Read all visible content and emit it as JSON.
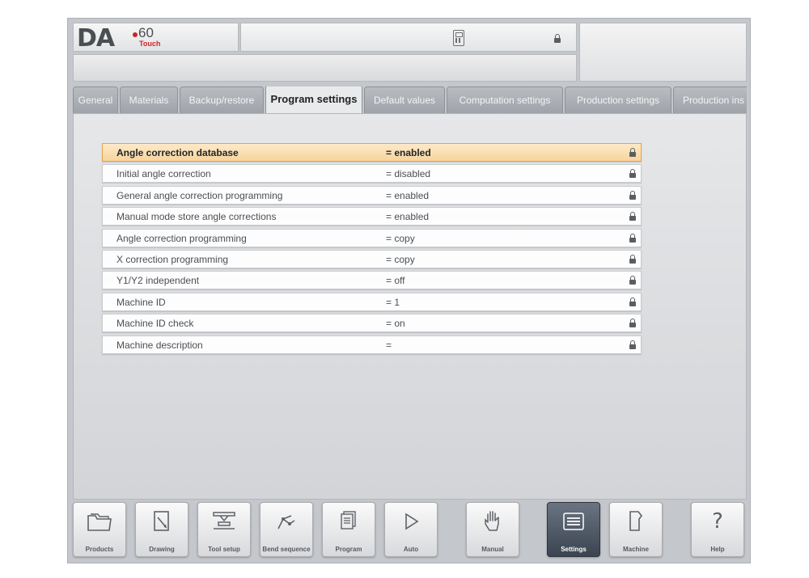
{
  "header": {
    "logo_text": "DA",
    "logo_model": "60",
    "logo_sub": "Touch"
  },
  "tabs": [
    {
      "label": "General"
    },
    {
      "label": "Materials"
    },
    {
      "label": "Backup/restore"
    },
    {
      "label": "Program settings",
      "active": true
    },
    {
      "label": "Default values"
    },
    {
      "label": "Computation settings"
    },
    {
      "label": "Production settings"
    },
    {
      "label": "Production ins"
    }
  ],
  "settings": [
    {
      "label": "Angle correction database",
      "value": "= enabled",
      "selected": true
    },
    {
      "label": "Initial angle correction",
      "value": "= disabled"
    },
    {
      "label": "General angle correction programming",
      "value": "= enabled"
    },
    {
      "label": "Manual mode store angle corrections",
      "value": "= enabled"
    },
    {
      "label": "Angle correction programming",
      "value": "= copy"
    },
    {
      "label": "X correction programming",
      "value": "= copy"
    },
    {
      "label": "Y1/Y2 independent",
      "value": "= off"
    },
    {
      "label": "Machine ID",
      "value": "= 1"
    },
    {
      "label": "Machine ID check",
      "value": "= on"
    },
    {
      "label": "Machine description",
      "value": "="
    }
  ],
  "footer": [
    {
      "label": "Products",
      "icon": "folder-icon"
    },
    {
      "label": "Drawing",
      "icon": "drawing-icon"
    },
    {
      "label": "Tool setup",
      "icon": "tool-setup-icon"
    },
    {
      "label": "Bend sequence",
      "icon": "bend-sequence-icon"
    },
    {
      "label": "Program",
      "icon": "program-icon"
    },
    {
      "label": "Auto",
      "icon": "play-icon"
    },
    {
      "label": "Manual",
      "icon": "hand-icon"
    },
    {
      "label": "Settings",
      "icon": "settings-list-icon",
      "active": true
    },
    {
      "label": "Machine",
      "icon": "machine-icon"
    },
    {
      "label": "Help",
      "icon": "help-icon"
    }
  ],
  "colors": {
    "selected_row": "#f7d59d",
    "brand_red": "#c9252c",
    "active_button": "#3b4450"
  }
}
